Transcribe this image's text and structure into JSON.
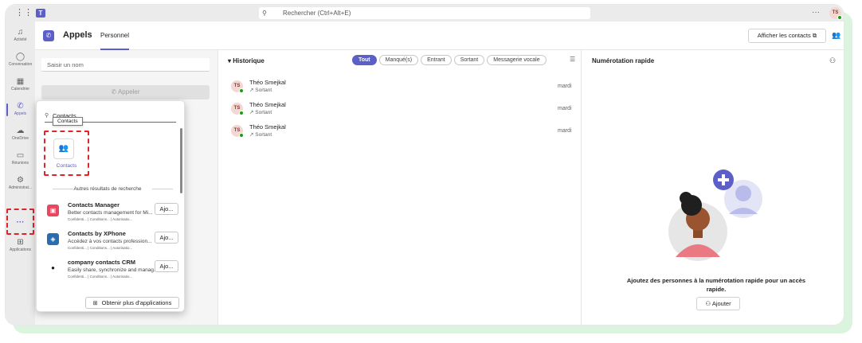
{
  "topbar": {
    "search_placeholder": "Rechercher (Ctrl+Alt+E)",
    "more_label": "···",
    "user_initials": "TS"
  },
  "rail": {
    "items": [
      {
        "label": "Activité",
        "icon": "bell-icon"
      },
      {
        "label": "Conversation",
        "icon": "chat-icon"
      },
      {
        "label": "Calendrier",
        "icon": "calendar-icon"
      },
      {
        "label": "Appels",
        "icon": "phone-icon"
      },
      {
        "label": "OneDrive",
        "icon": "cloud-icon"
      },
      {
        "label": "Réunions",
        "icon": "video-icon"
      },
      {
        "label": "Administrat...",
        "icon": "admin-icon"
      },
      {
        "label": "···",
        "icon": "more-icon"
      },
      {
        "label": "Applications",
        "icon": "apps-icon"
      }
    ],
    "active_item": "Appels"
  },
  "header": {
    "title": "Appels",
    "tab": "Personnel",
    "contacts_button": "Afficher les contacts"
  },
  "dialer": {
    "name_placeholder": "Saisir un nom",
    "call_button": "Appeler"
  },
  "history": {
    "title": "Historique",
    "filters": [
      "Tout",
      "Manqué(s)",
      "Entrant",
      "Sortant",
      "Messagerie vocale"
    ],
    "active_filter": "Tout",
    "calls": [
      {
        "initials": "TS",
        "name": "Théo Smejkal",
        "direction": "Sortant",
        "date": "mardi"
      },
      {
        "initials": "TS",
        "name": "Théo Smejkal",
        "direction": "Sortant",
        "date": "mardi"
      },
      {
        "initials": "TS",
        "name": "Théo Smejkal",
        "direction": "Sortant",
        "date": "mardi"
      }
    ]
  },
  "speed_dial": {
    "title": "Numérotation rapide",
    "empty_text": "Ajoutez des personnes à la numérotation rapide pour un accès rapide.",
    "add_button": "Ajouter"
  },
  "popup": {
    "search_value": "Contacts",
    "tooltip": "Contacts",
    "tile_label": "Contacts",
    "section_label": "Autres résultats de recherche",
    "apps": [
      {
        "name": "Contacts Manager",
        "desc": "Better contacts management for Mi...",
        "meta": "Confidenti... | Conditions... | Autorisatio...",
        "button": "Ajo...",
        "logo_color": "#e8475f"
      },
      {
        "name": "Contacts by XPhone",
        "desc": "Accédez à vos contacts profession...",
        "meta": "Confidenti... | Conditions... | Autorisatio...",
        "button": "Ajo...",
        "logo_color": "#2b6cb0"
      },
      {
        "name": "company contacts CRM",
        "desc": "Easily share, synchronize and manag...",
        "meta": "Confidenti... | Conditions... | Autorisatio...",
        "button": "Ajo...",
        "logo_color": "#1a1a1a"
      }
    ],
    "more_apps_button": "Obtenir plus d'applications"
  },
  "colors": {
    "brand": "#5b5fc7",
    "highlight": "#e0242c",
    "presence": "#13a10e"
  }
}
